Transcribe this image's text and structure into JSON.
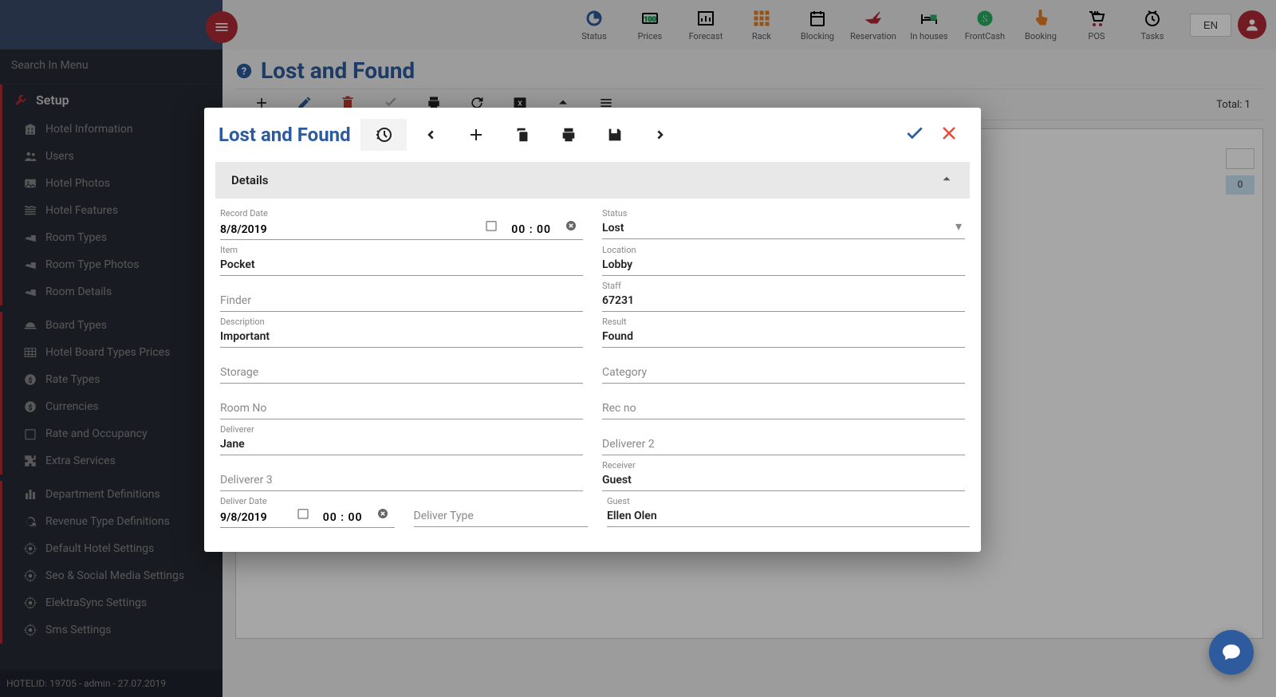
{
  "topnav": {
    "items": [
      {
        "label": "Status",
        "icon": "pie",
        "color": "#2d5b9e"
      },
      {
        "label": "Prices",
        "icon": "money-bars",
        "color": "#27ae60"
      },
      {
        "label": "Forecast",
        "icon": "bar-chart",
        "color": "#27ae60"
      },
      {
        "label": "Rack",
        "icon": "grid",
        "color": "#e67e22"
      },
      {
        "label": "Blocking",
        "icon": "calendar",
        "color": "#8e44ad"
      },
      {
        "label": "Reservation",
        "icon": "plane",
        "color": "#b02a37"
      },
      {
        "label": "In houses",
        "icon": "bed",
        "color": "#27ae60"
      },
      {
        "label": "FrontCash",
        "icon": "dollar",
        "color": "#27ae60"
      },
      {
        "label": "Booking",
        "icon": "touch",
        "color": "#e67e22"
      },
      {
        "label": "POS",
        "icon": "cart",
        "color": "#b02a37"
      },
      {
        "label": "Tasks",
        "icon": "clock",
        "color": "#e67e22"
      }
    ],
    "lang": "EN"
  },
  "sidebar": {
    "search_placeholder": "Search In Menu",
    "section": "Setup",
    "items": [
      {
        "label": "Hotel Information",
        "icon": "building"
      },
      {
        "label": "Users",
        "icon": "users"
      },
      {
        "label": "Hotel Photos",
        "icon": "image"
      },
      {
        "label": "Hotel Features",
        "icon": "features"
      },
      {
        "label": "Room Types",
        "icon": "bed"
      },
      {
        "label": "Room Type Photos",
        "icon": "bed"
      },
      {
        "label": "Room Details",
        "icon": "bed"
      },
      {
        "label": "Board Types",
        "icon": "dish"
      },
      {
        "label": "Hotel Board Types Prices",
        "icon": "table"
      },
      {
        "label": "Rate Types",
        "icon": "dollar"
      },
      {
        "label": "Currencies",
        "icon": "dollar"
      },
      {
        "label": "Rate and Occupancy",
        "icon": "calendar"
      },
      {
        "label": "Extra Services",
        "icon": "puzzle"
      },
      {
        "label": "Department Definitions",
        "icon": "dept"
      },
      {
        "label": "Revenue Type Definitions",
        "icon": "cycle"
      },
      {
        "label": "Default Hotel Settings",
        "icon": "gear"
      },
      {
        "label": "Seo & Social Media Settings",
        "icon": "gear"
      },
      {
        "label": "ElektraSync Settings",
        "icon": "gear"
      },
      {
        "label": "Sms Settings",
        "icon": "gear"
      }
    ],
    "footer": "HOTELID: 19705 - admin - 27.07.2019"
  },
  "page": {
    "title": "Lost and Found",
    "total_label": "Total: 1",
    "hidden_cell": "0"
  },
  "modal": {
    "title": "Lost and Found",
    "section_title": "Details",
    "fields": {
      "record_date": {
        "label": "Record Date",
        "date": "8/8/2019",
        "time": "00 : 00"
      },
      "status": {
        "label": "Status",
        "value": "Lost"
      },
      "item": {
        "label": "Item",
        "value": "Pocket"
      },
      "location": {
        "label": "Location",
        "value": "Lobby"
      },
      "finder": {
        "label": "Finder",
        "value": ""
      },
      "staff": {
        "label": "Staff",
        "value": "67231"
      },
      "description": {
        "label": "Description",
        "value": "Important"
      },
      "result": {
        "label": "Result",
        "value": "Found"
      },
      "storage": {
        "label": "Storage",
        "value": ""
      },
      "category": {
        "label": "Category",
        "value": ""
      },
      "room_no": {
        "label": "Room No",
        "value": ""
      },
      "rec_no": {
        "label": "Rec no",
        "value": ""
      },
      "deliverer": {
        "label": "Deliverer",
        "value": "Jane"
      },
      "deliverer2": {
        "label": "Deliverer 2",
        "value": ""
      },
      "deliverer3": {
        "label": "Deliverer 3",
        "value": ""
      },
      "receiver": {
        "label": "Receiver",
        "value": "Guest"
      },
      "deliver_date": {
        "label": "Deliver Date",
        "date": "9/8/2019",
        "time": "00 : 00"
      },
      "deliver_type": {
        "label": "Deliver Type",
        "value": ""
      },
      "guest": {
        "label": "Guest",
        "value": "Ellen Olen"
      }
    }
  }
}
